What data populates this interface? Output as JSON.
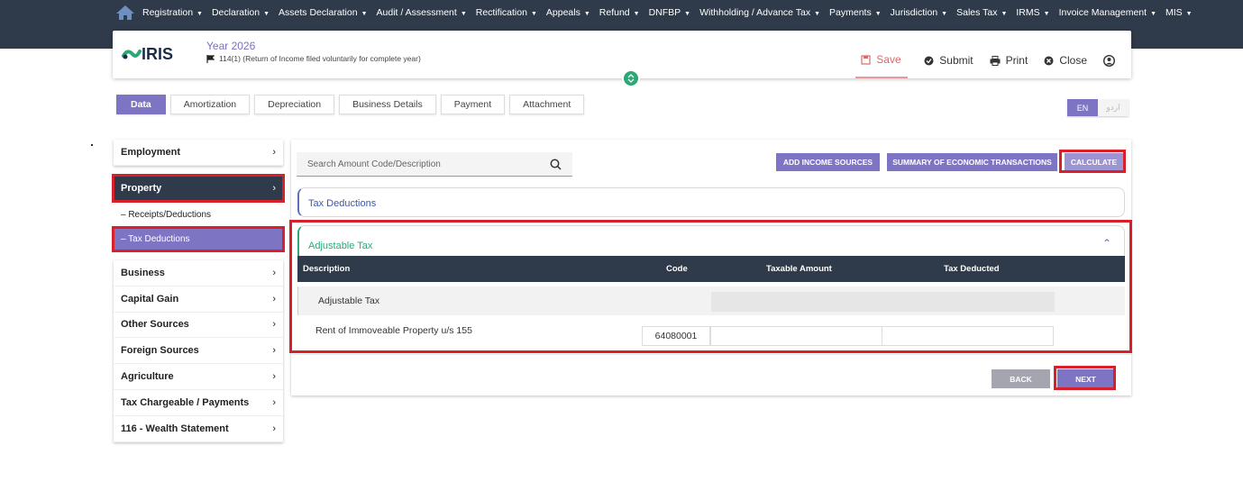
{
  "nav": {
    "items": [
      "Registration",
      "Declaration",
      "Assets Declaration",
      "Audit / Assessment",
      "Rectification",
      "Appeals",
      "Refund",
      "DNFBP",
      "Withholding / Advance Tax",
      "Payments",
      "Jurisdiction",
      "Sales Tax",
      "IRMS",
      "Invoice Management",
      "MIS"
    ]
  },
  "header": {
    "logo_text": "IRIS",
    "year": "Year 2026",
    "subtitle": "114(1) (Return of Income filed voluntarily for complete year)",
    "actions": {
      "save": "Save",
      "submit": "Submit",
      "print": "Print",
      "close": "Close"
    }
  },
  "tabs": [
    "Data",
    "Amortization",
    "Depreciation",
    "Business Details",
    "Payment",
    "Attachment"
  ],
  "lang": {
    "en": "EN",
    "ur": "اردو"
  },
  "sidebar": {
    "employment": "Employment",
    "property": "Property",
    "sub_receipts": "– Receipts/Deductions",
    "sub_tax_deductions": "– Tax Deductions",
    "items": [
      "Business",
      "Capital Gain",
      "Other Sources",
      "Foreign Sources",
      "Agriculture",
      "Tax Chargeable / Payments",
      "116 - Wealth Statement"
    ]
  },
  "main": {
    "search_placeholder": "Search Amount Code/Description",
    "buttons": {
      "add_income": "ADD INCOME SOURCES",
      "summary": "SUMMARY OF ECONOMIC TRANSACTIONS",
      "calculate": "CALCULATE"
    },
    "tax_deductions_title": "Tax Deductions",
    "adjustable_title": "Adjustable Tax",
    "columns": {
      "description": "Description",
      "code": "Code",
      "taxable": "Taxable Amount",
      "deducted": "Tax Deducted"
    },
    "row1_label": "Adjustable Tax",
    "row2": {
      "label": "Rent of Immoveable Property u/s 155",
      "code": "64080001",
      "taxable": "",
      "deducted": ""
    },
    "back": "BACK",
    "next": "NEXT"
  }
}
